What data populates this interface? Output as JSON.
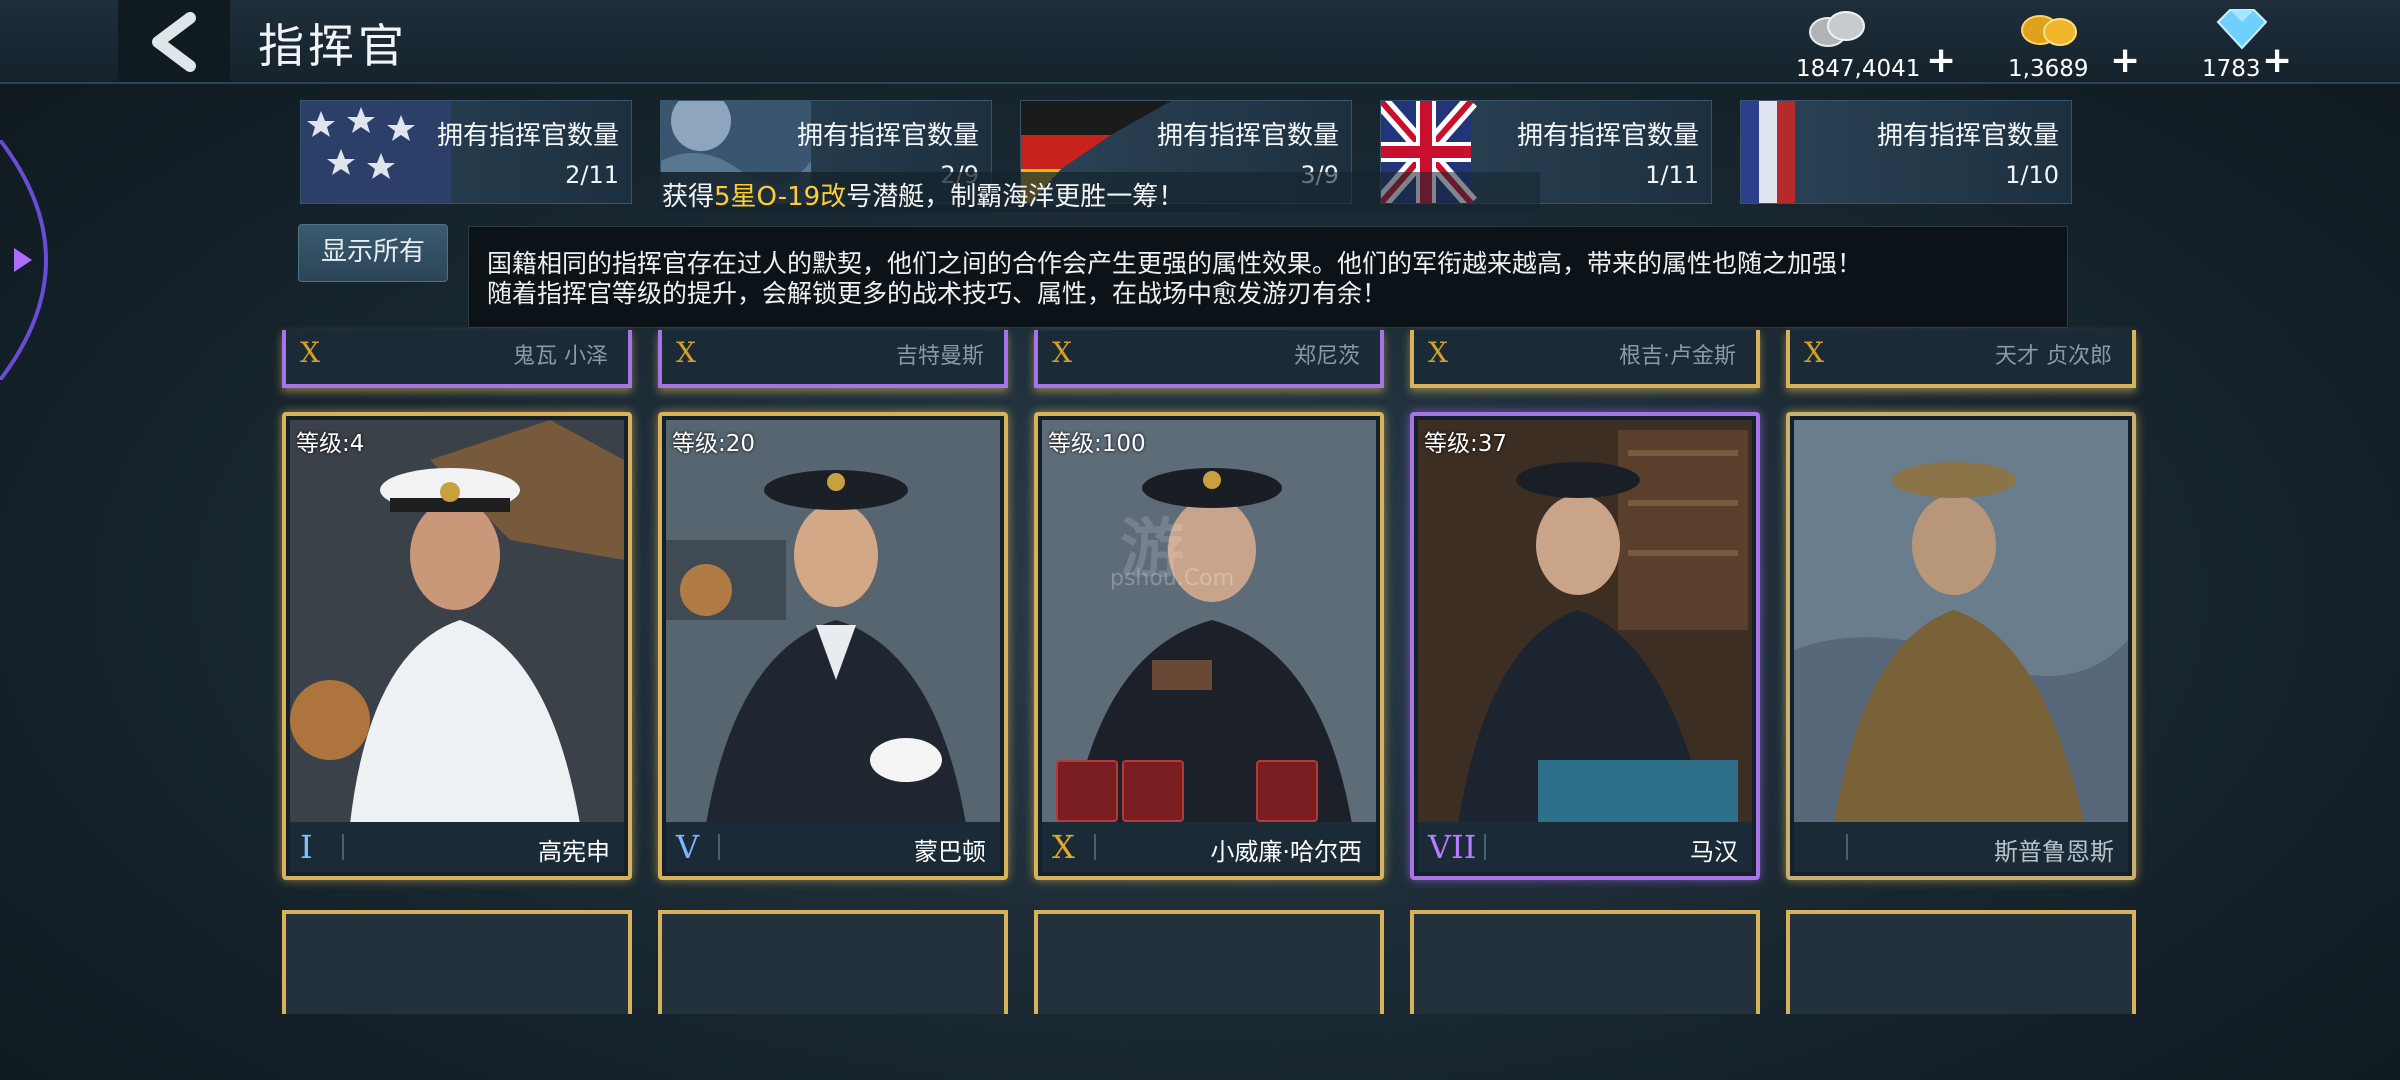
{
  "header": {
    "title": "指挥官",
    "resources": [
      {
        "icon": "silver-coin-icon",
        "value": "1847,4041",
        "plus": "+"
      },
      {
        "icon": "gold-coin-icon",
        "value": "1,3689",
        "plus": "+"
      },
      {
        "icon": "diamond-icon",
        "value": "1783",
        "plus": "+"
      }
    ]
  },
  "nations": [
    {
      "flag": "usa",
      "label": "拥有指挥官数量",
      "count": "2/11"
    },
    {
      "flag": "japan",
      "label": "拥有指挥官数量",
      "count": "2/9"
    },
    {
      "flag": "germany",
      "label": "拥有指挥官数量",
      "count": "3/9"
    },
    {
      "flag": "uk",
      "label": "拥有指挥官数量",
      "count": "1/11"
    },
    {
      "flag": "france",
      "label": "拥有指挥官数量",
      "count": "1/10"
    }
  ],
  "broadcast": {
    "prefix": "获得",
    "highlight": "5星O-19改",
    "suffix": "号潜艇，制霸海洋更胜一筹！"
  },
  "show_all_label": "显示所有",
  "tip": {
    "line1": "国籍相同的指挥官存在过人的默契，他们之间的合作会产生更强的属性效果。他们的军衔越来越高，带来的属性也随之加强！",
    "line2": "随着指挥官等级的提升，会解锁更多的战术技巧、属性，在战场中愈发游刃有余！"
  },
  "top_row": [
    {
      "rank": "X",
      "name": "鬼瓦 小泽"
    },
    {
      "rank": "X",
      "name": "吉特曼斯"
    },
    {
      "rank": "X",
      "name": "郑尼茨"
    },
    {
      "rank": "X",
      "name": "根吉·卢金斯"
    },
    {
      "rank": "X",
      "name": "天才 贞次郎"
    }
  ],
  "cards": [
    {
      "level": "等级:4",
      "rank": "I",
      "rank_color": "#7fc4ff",
      "name": "高宪申"
    },
    {
      "level": "等级:20",
      "rank": "V",
      "rank_color": "#7fb6ff",
      "name": "蒙巴顿"
    },
    {
      "level": "等级:100",
      "rank": "X",
      "rank_color": "#e0a928",
      "name": "小威廉·哈尔西"
    },
    {
      "level": "等级:37",
      "rank": "VII",
      "rank_color": "#b57cff",
      "name": "马汉"
    },
    {
      "level": "",
      "rank": "",
      "rank_color": "#888888",
      "name": "斯普鲁恩斯"
    }
  ],
  "watermark": {
    "main": "游",
    "sub": "pshou.Com"
  }
}
